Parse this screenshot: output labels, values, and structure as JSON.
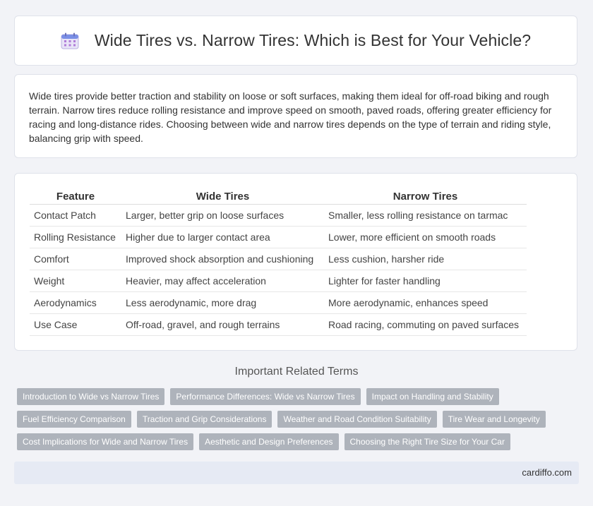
{
  "header": {
    "title": "Wide Tires vs. Narrow Tires: Which is Best for Your Vehicle?",
    "icon": "calendar-icon"
  },
  "intro": {
    "text": "Wide tires provide better traction and stability on loose or soft surfaces, making them ideal for off-road biking and rough terrain. Narrow tires reduce rolling resistance and improve speed on smooth, paved roads, offering greater efficiency for racing and long-distance rides. Choosing between wide and narrow tires depends on the type of terrain and riding style, balancing grip with speed."
  },
  "comparison": {
    "headers": [
      "Feature",
      "Wide Tires",
      "Narrow Tires"
    ],
    "rows": [
      [
        "Contact Patch",
        "Larger, better grip on loose surfaces",
        "Smaller, less rolling resistance on tarmac"
      ],
      [
        "Rolling Resistance",
        "Higher due to larger contact area",
        "Lower, more efficient on smooth roads"
      ],
      [
        "Comfort",
        "Improved shock absorption and cushioning",
        "Less cushion, harsher ride"
      ],
      [
        "Weight",
        "Heavier, may affect acceleration",
        "Lighter for faster handling"
      ],
      [
        "Aerodynamics",
        "Less aerodynamic, more drag",
        "More aerodynamic, enhances speed"
      ],
      [
        "Use Case",
        "Off-road, gravel, and rough terrains",
        "Road racing, commuting on paved surfaces"
      ]
    ]
  },
  "related": {
    "title": "Important Related Terms",
    "rows": [
      [
        "Introduction to Wide vs Narrow Tires",
        "Performance Differences: Wide vs Narrow Tires",
        "Impact on Handling and Stability"
      ],
      [
        "Fuel Efficiency Comparison",
        "Traction and Grip Considerations",
        "Weather and Road Condition Suitability",
        "Tire Wear and Longevity"
      ],
      [
        "Cost Implications for Wide and Narrow Tires",
        "Aesthetic and Design Preferences",
        "Choosing the Right Tire Size for Your Car"
      ]
    ]
  },
  "footer": {
    "site": "cardiffo.com"
  }
}
